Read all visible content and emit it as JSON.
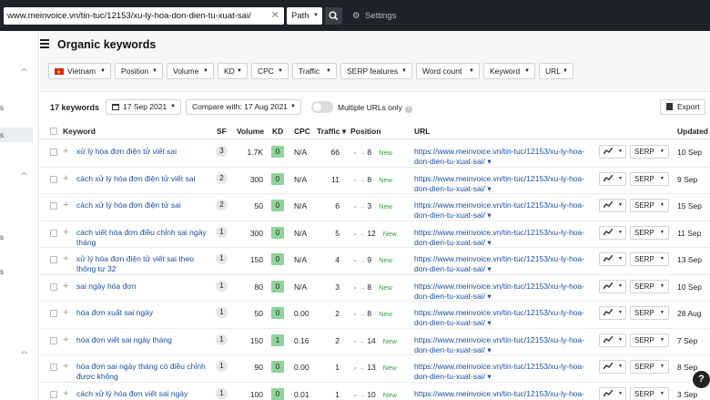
{
  "topbar": {
    "url_value": "www.meinvoice.vn/tin-tuc/12153/xu-ly-hoa-don-dien-tu-xuat-sai/",
    "clear_glyph": "✕",
    "path_label": "Path",
    "settings_label": "Settings"
  },
  "sidebar": {
    "fragments": [
      "s",
      "s",
      "s",
      "s"
    ]
  },
  "header": {
    "title": "Organic keywords"
  },
  "filters": {
    "country": "Vietnam",
    "position": "Position",
    "volume": "Volume",
    "kd": "KD",
    "cpc": "CPC",
    "traffic": "Traffic",
    "serp_features": "SERP features",
    "word_count": "Word count",
    "keyword": "Keyword",
    "url": "URL"
  },
  "toolbar": {
    "count": "17 keywords",
    "date": "17 Sep 2021",
    "compare": "Compare with: 17 Aug 2021",
    "multiple_urls": "Multiple URLs only",
    "export": "Export"
  },
  "columns": {
    "keyword": "Keyword",
    "sf": "SF",
    "volume": "Volume",
    "kd": "KD",
    "cpc": "CPC",
    "traffic": "Traffic ▾",
    "position": "Position",
    "url": "URL",
    "updated": "Updated"
  },
  "colors": {
    "topbar": "#1f2227",
    "link": "#1a4fa3",
    "kd_badge": "#8fd49b",
    "new_label": "#3b9c4b"
  },
  "rows": [
    {
      "keyword": "xử lý hóa đơn điện tử viết sai",
      "sf": "3",
      "volume": "1.7K",
      "kd": "0",
      "cpc": "N/A",
      "traffic": "66",
      "position": "8",
      "status": "New",
      "url": "https://www.meinvoice.vn/tin-tuc/12153/xu-ly-hoa-don-dien-tu-xuat-sai/ ▾",
      "trend": "~",
      "serp": "SERP",
      "updated": "10 Sep"
    },
    {
      "keyword": "cách xử lý hóa đơn điện tử viết sai",
      "sf": "2",
      "volume": "300",
      "kd": "0",
      "cpc": "N/A",
      "traffic": "11",
      "position": "8",
      "status": "New",
      "url": "https://www.meinvoice.vn/tin-tuc/12153/xu-ly-hoa-don-dien-tu-xuat-sai/ ▾",
      "trend": "~",
      "serp": "SERP",
      "updated": "9 Sep"
    },
    {
      "keyword": "cách xử lý hóa đơn điện tử sai",
      "sf": "2",
      "volume": "50",
      "kd": "0",
      "cpc": "N/A",
      "traffic": "6",
      "position": "3",
      "status": "New",
      "url": "https://www.meinvoice.vn/tin-tuc/12153/xu-ly-hoa-don-dien-tu-xuat-sai/ ▾",
      "trend": "~",
      "serp": "SERP",
      "updated": "15 Sep"
    },
    {
      "keyword": "cách viết hóa đơn điều chỉnh sai ngày tháng",
      "sf": "1",
      "volume": "300",
      "kd": "0",
      "cpc": "N/A",
      "traffic": "5",
      "position": "12",
      "status": "New",
      "url": "https://www.meinvoice.vn/tin-tuc/12153/xu-ly-hoa-don-dien-tu-xuat-sai/ ▾",
      "trend": "~",
      "serp": "SERP",
      "updated": "11 Sep"
    },
    {
      "keyword": "xử lý hóa đơn điện tử viết sai theo thông tư 32",
      "sf": "1",
      "volume": "150",
      "kd": "0",
      "cpc": "N/A",
      "traffic": "4",
      "position": "9",
      "status": "New",
      "url": "https://www.meinvoice.vn/tin-tuc/12153/xu-ly-hoa-don-dien-tu-xuat-sai/ ▾",
      "trend": "~",
      "serp": "SERP",
      "updated": "13 Sep"
    },
    {
      "keyword": "sai ngày hóa đơn",
      "sf": "1",
      "volume": "80",
      "kd": "0",
      "cpc": "N/A",
      "traffic": "3",
      "position": "8",
      "status": "New",
      "url": "https://www.meinvoice.vn/tin-tuc/12153/xu-ly-hoa-don-dien-tu-xuat-sai/ ▾",
      "trend": "~",
      "serp": "SERP",
      "updated": "10 Sep"
    },
    {
      "keyword": "hóa đơn xuất sai ngày",
      "sf": "1",
      "volume": "50",
      "kd": "0",
      "cpc": "0.00",
      "traffic": "2",
      "position": "8",
      "status": "New",
      "url": "https://www.meinvoice.vn/tin-tuc/12153/xu-ly-hoa-don-dien-tu-xuat-sai/ ▾",
      "trend": "~",
      "serp": "SERP",
      "updated": "28 Aug"
    },
    {
      "keyword": "hóa đơn viết sai ngày tháng",
      "sf": "1",
      "volume": "150",
      "kd": "1",
      "cpc": "0.16",
      "traffic": "2",
      "position": "14",
      "status": "New",
      "url": "https://www.meinvoice.vn/tin-tuc/12153/xu-ly-hoa-don-dien-tu-xuat-sai/ ▾",
      "trend": "~",
      "serp": "SERP",
      "updated": "7 Sep"
    },
    {
      "keyword": "hóa đơn sai ngày tháng có điều chỉnh được không",
      "sf": "1",
      "volume": "90",
      "kd": "0",
      "cpc": "0.00",
      "traffic": "1",
      "position": "13",
      "status": "New",
      "url": "https://www.meinvoice.vn/tin-tuc/12153/xu-ly-hoa-don-dien-tu-xuat-sai/ ▾",
      "trend": "~",
      "serp": "SERP",
      "updated": "8 Sep"
    },
    {
      "keyword": "cách xử lý hóa đơn viết sai ngày",
      "sf": "1",
      "volume": "100",
      "kd": "0",
      "cpc": "0.01",
      "traffic": "1",
      "position": "10",
      "status": "New",
      "url": "https://www.meinvoice.vn/tin-tuc/12153/xu-ly-hoa-don-dien-tu-xuat-sai/ ▾",
      "trend": "~",
      "serp": "SERP",
      "updated": "3 Sep"
    }
  ],
  "help_glyph": "?"
}
